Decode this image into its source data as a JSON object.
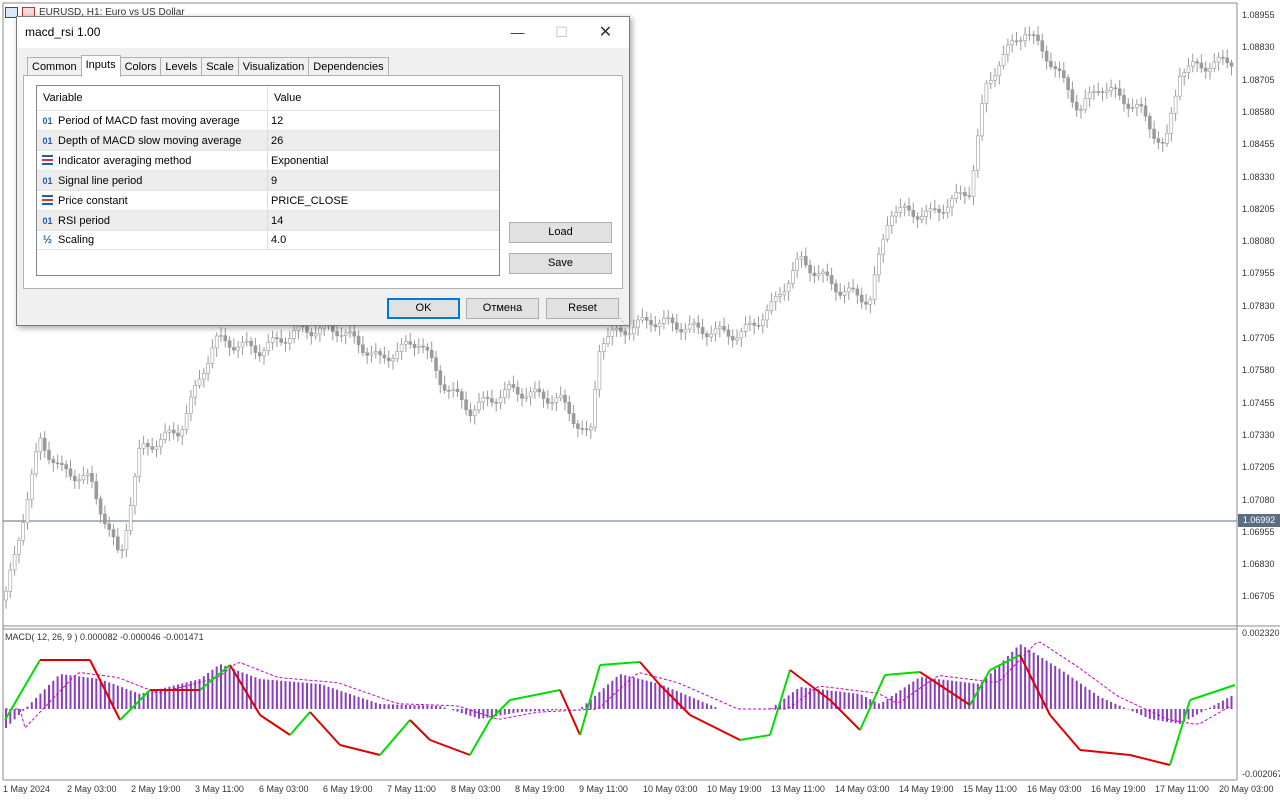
{
  "chart": {
    "symbol_header": "EURUSD, H1:  Euro vs US Dollar",
    "current_price": "1.06992",
    "price_axis": [
      "1.08955",
      "1.08830",
      "1.08705",
      "1.08580",
      "1.08455",
      "1.08330",
      "1.08205",
      "1.08080",
      "1.07955",
      "1.07830",
      "1.07705",
      "1.07580",
      "1.07455",
      "1.07330",
      "1.07205",
      "1.07080",
      "1.06955",
      "1.06830",
      "1.06705"
    ],
    "time_axis": [
      "1 May 2024",
      "2 May 03:00",
      "2 May 19:00",
      "3 May 11:00",
      "6 May 03:00",
      "6 May 19:00",
      "7 May 11:00",
      "8 May 03:00",
      "8 May 19:00",
      "9 May 11:00",
      "10 May 03:00",
      "10 May 19:00",
      "13 May 11:00",
      "14 May 03:00",
      "14 May 19:00",
      "15 May 11:00",
      "16 May 03:00",
      "16 May 19:00",
      "17 May 11:00",
      "20 May 03:00"
    ],
    "indicator_title": "MACD( 12, 26, 9 ) 0.000082 -0.000046 -0.001471",
    "indicator_axis_top": "0.002320",
    "indicator_axis_bottom": "-0.002067",
    "colors": {
      "candle": "#9a9a9a",
      "histogram": "#8a3fbf",
      "signal": "#cc00cc",
      "rsi_up": "#00dd00",
      "rsi_down": "#dd0000",
      "price_line": "#5a6e82"
    }
  },
  "dialog": {
    "title": "macd_rsi 1.00",
    "tabs": [
      "Common",
      "Inputs",
      "Colors",
      "Levels",
      "Scale",
      "Visualization",
      "Dependencies"
    ],
    "active_tab": "Inputs",
    "grid_headers": {
      "variable": "Variable",
      "value": "Value"
    },
    "params": [
      {
        "icon": "01",
        "name": "Period of MACD fast moving average",
        "value": "12"
      },
      {
        "icon": "01",
        "name": "Depth of MACD slow moving average",
        "value": "26"
      },
      {
        "icon": "enum",
        "name": "Indicator averaging method",
        "value": "Exponential"
      },
      {
        "icon": "01",
        "name": "Signal line period",
        "value": "9"
      },
      {
        "icon": "enum",
        "name": "Price constant",
        "value": "PRICE_CLOSE"
      },
      {
        "icon": "01",
        "name": "RSI period",
        "value": "14"
      },
      {
        "icon": "½",
        "name": "Scaling",
        "value": "4.0"
      }
    ],
    "buttons": {
      "load": "Load",
      "save": "Save",
      "ok": "OK",
      "cancel": "Отмена",
      "reset": "Reset"
    }
  }
}
